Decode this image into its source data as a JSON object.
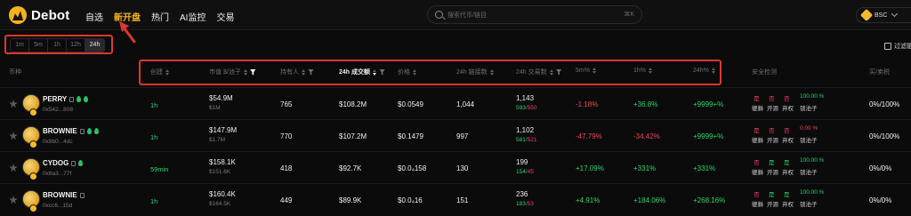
{
  "app": {
    "name": "Debot"
  },
  "nav": [
    "自选",
    "新开盘",
    "热门",
    "AI监控",
    "交易"
  ],
  "search": {
    "placeholder": "搜索代币/链目",
    "shortcut": "⌘K"
  },
  "chain": {
    "label": "BSC"
  },
  "time_filters": [
    "1m",
    "5m",
    "1h",
    "12h",
    "24h"
  ],
  "filter_checkbox_label": "过滤貔",
  "columns": {
    "token": "币种",
    "age": "创建",
    "mcap": "市值 $/池子",
    "holders": "持有人",
    "volume": "24h 成交额",
    "price": "价格",
    "txcount": "24h 链接数",
    "trades": "24h 交易数",
    "m5": "5m%",
    "h1": "1h%",
    "h24": "24h%",
    "security": "安全检测",
    "tax": "买/卖税"
  },
  "rows": [
    {
      "name": "PERRY",
      "addr": "0x542...808",
      "age": "1h",
      "mcap": "$54.9M",
      "pool": "$1M",
      "holders": "765",
      "volume": "$108.2M",
      "price": "$0.0549",
      "txcount": "1,044",
      "trades": "1,143",
      "buys": "593",
      "sells": "550",
      "m5": "-1.18%",
      "h1": "+36.8%",
      "h24": "+9999+%",
      "sec_top": [
        "是",
        "否",
        "否",
        "100.00 %"
      ],
      "sec_bottom": [
        "貔貅",
        "开源",
        "弃权",
        "锁池子"
      ],
      "tax": "0%/100%"
    },
    {
      "name": "BROWNIE",
      "addr": "0x9b0...4dc",
      "age": "1h",
      "mcap": "$147.9M",
      "pool": "$1.7M",
      "holders": "770",
      "volume": "$107.2M",
      "price": "$0.1479",
      "txcount": "997",
      "trades": "1,102",
      "buys": "581",
      "sells": "521",
      "m5": "-47.79%",
      "h1": "-34.42%",
      "h24": "+9999+%",
      "sec_top": [
        "是",
        "否",
        "否",
        "0.00 %"
      ],
      "sec_bottom": [
        "貔貅",
        "开源",
        "弃权",
        "锁池子"
      ],
      "tax": "0%/100%"
    },
    {
      "name": "CYDOG",
      "addr": "0x8a3...77f",
      "age": "59min",
      "mcap": "$158.1K",
      "pool": "$151.6K",
      "holders": "418",
      "volume": "$92.7K",
      "price": "$0.0₄158",
      "txcount": "130",
      "trades": "199",
      "buys": "154",
      "sells": "45",
      "m5": "+17.09%",
      "h1": "+331%",
      "h24": "+331%",
      "sec_top": [
        "否",
        "是",
        "是",
        "100.00 %"
      ],
      "sec_bottom": [
        "貔貅",
        "开源",
        "弃权",
        "锁池子"
      ],
      "tax": "0%/0%"
    },
    {
      "name": "BROWNIE",
      "addr": "0xcc6...15d",
      "age": "1h",
      "mcap": "$160.4K",
      "pool": "$164.5K",
      "holders": "449",
      "volume": "$89.9K",
      "price": "$0.0₄16",
      "txcount": "151",
      "trades": "236",
      "buys": "183",
      "sells": "53",
      "m5": "+4.91%",
      "h1": "+184.06%",
      "h24": "+268.16%",
      "sec_top": [
        "否",
        "是",
        "是",
        "100.00 %"
      ],
      "sec_bottom": [
        "貔貅",
        "开源",
        "弃权",
        "锁池子"
      ],
      "tax": "0%/0%"
    }
  ],
  "colors": {
    "accent": "#f6b21a",
    "up": "#2bd66d",
    "down": "#f0445a",
    "highlight_box": "#d8392f"
  }
}
